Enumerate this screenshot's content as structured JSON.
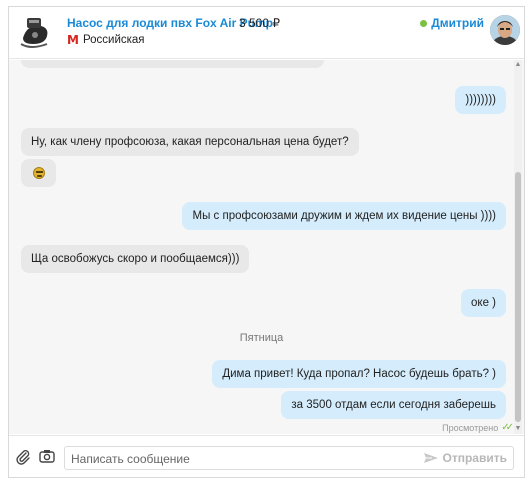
{
  "header": {
    "product_title": "Насос для лодки пвх Fox Air Pump",
    "price": "3 500 ₽",
    "metro_icon": "М",
    "metro_station": "Российская",
    "user_name": "Дмитрий",
    "online_color": "#7bc142"
  },
  "messages": [
    {
      "direction": "out",
      "text": "))))))))"
    },
    {
      "direction": "in",
      "text": "Ну, как члену профсоюза, какая персональная цена будет?"
    },
    {
      "direction": "in",
      "type": "emoji",
      "icon": "smiley-emoji-icon"
    },
    {
      "direction": "out",
      "text": "Мы с профсоюзами дружим и ждем их видение цены ))))"
    },
    {
      "direction": "in",
      "text": "Ща освобожусь скоро и пообщаемся)))"
    },
    {
      "direction": "out",
      "text": "оке )"
    },
    {
      "direction": "out",
      "text": "Дима привет! Куда пропал? Насос будешь брать? )"
    },
    {
      "direction": "out",
      "text": "за 3500 отдам если сегодня заберешь"
    }
  ],
  "day_separator": "Пятница",
  "read_status": "Просмотрено",
  "composer": {
    "placeholder": "Написать сообщение",
    "send_label": "Отправить"
  },
  "colors": {
    "accent": "#1a8ad6",
    "incoming_bubble": "#e8e8e8",
    "outgoing_bubble": "#d4ecfb"
  }
}
